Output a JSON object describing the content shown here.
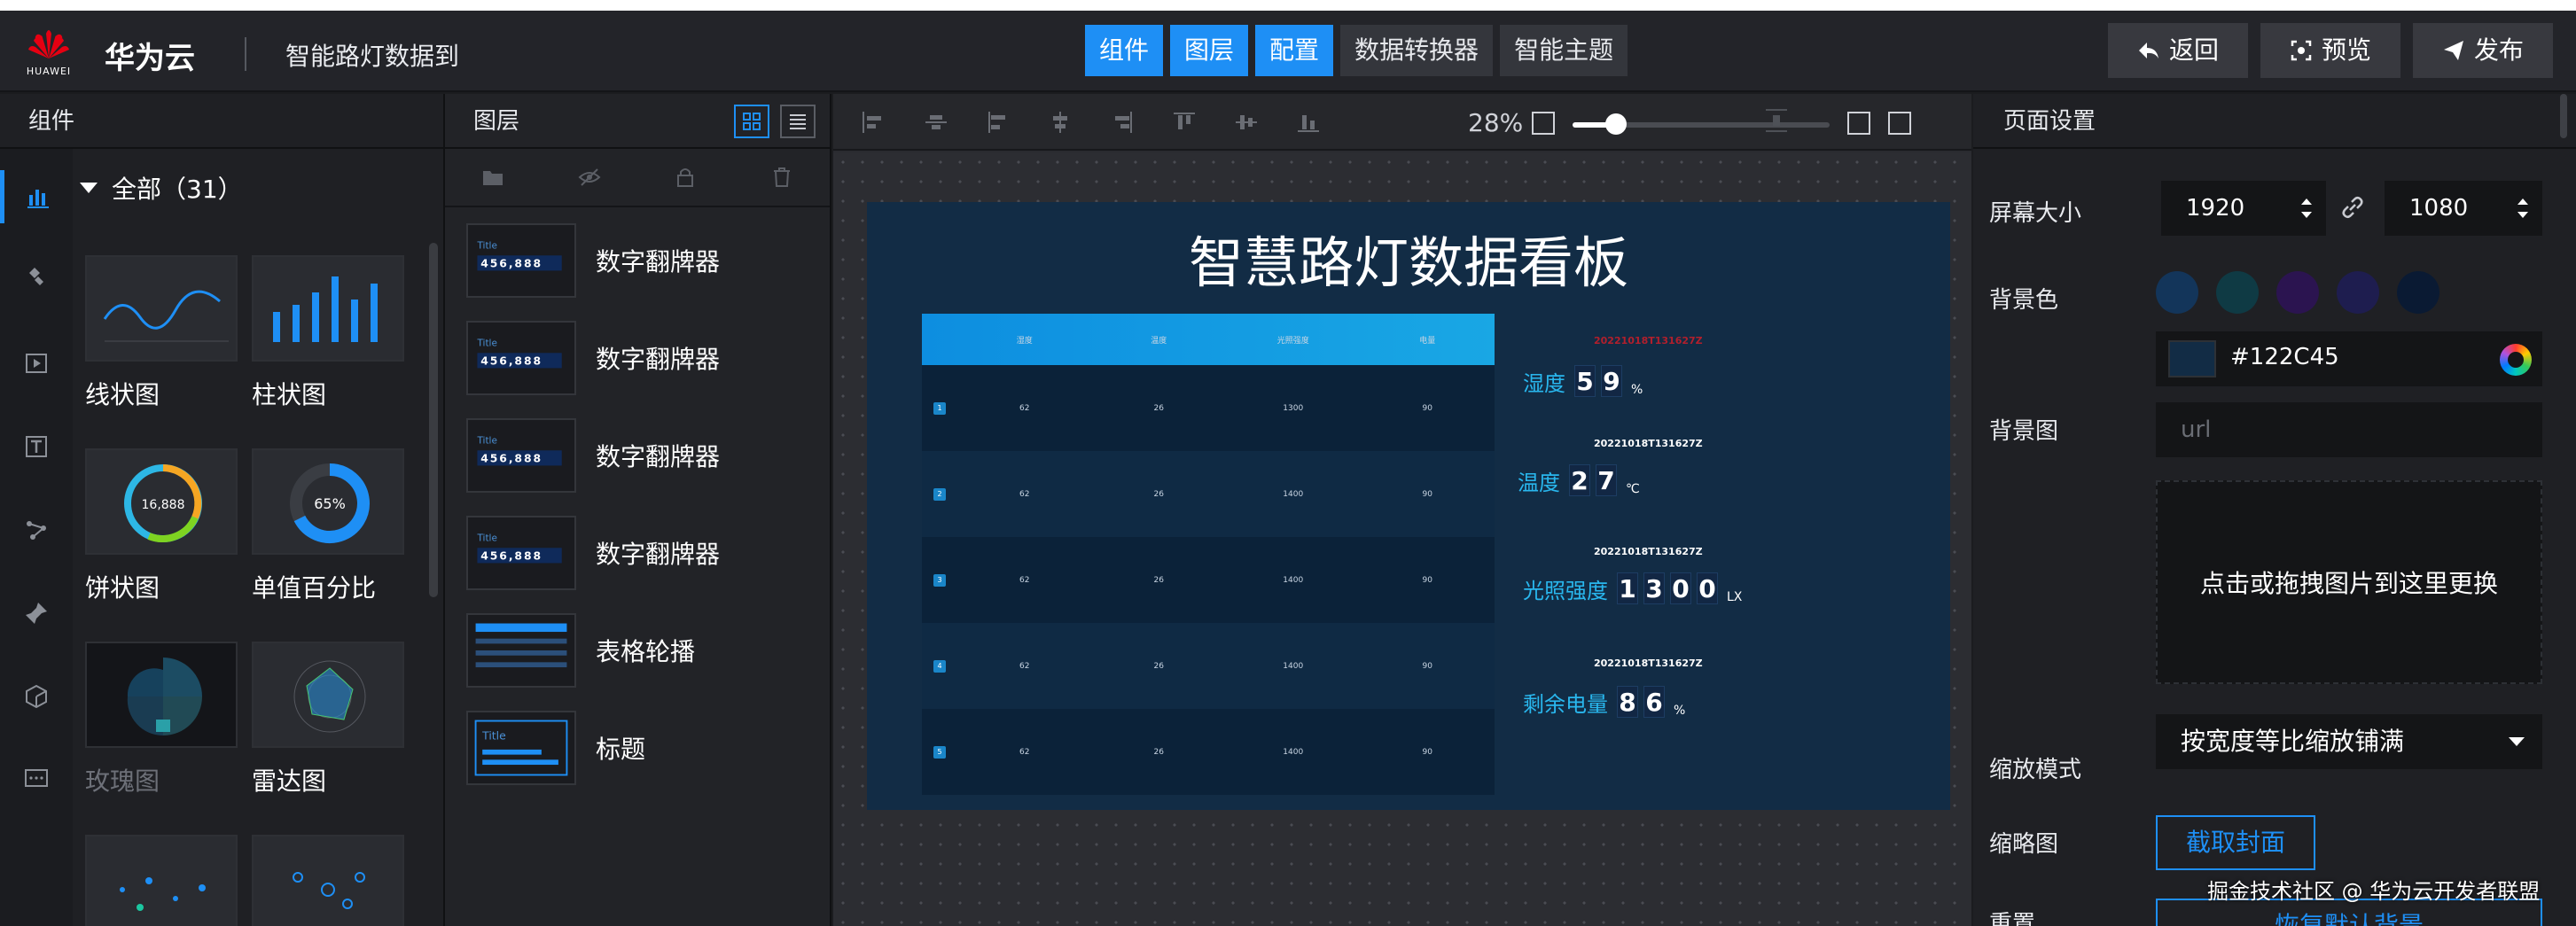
{
  "header": {
    "logo_text": "HUAWEI",
    "brand": "华为云",
    "project_name": "智能路灯数据到",
    "center_tabs": [
      {
        "label": "组件",
        "active": true
      },
      {
        "label": "图层",
        "active": true
      },
      {
        "label": "配置",
        "active": true
      },
      {
        "label": "数据转换器",
        "active": false
      },
      {
        "label": "智能主题",
        "active": false
      }
    ],
    "back_label": "返回",
    "preview_label": "预览",
    "publish_label": "发布"
  },
  "components_panel": {
    "title": "组件",
    "category": "全部（31）",
    "items": [
      {
        "label": "线状图",
        "icon": "line-chart-thumb",
        "disabled": false
      },
      {
        "label": "柱状图",
        "icon": "bar-chart-thumb",
        "disabled": false
      },
      {
        "label": "饼状图",
        "icon": "pie-chart-thumb",
        "thumb_value": "16,888",
        "disabled": false
      },
      {
        "label": "单值百分比",
        "icon": "percent-ring-thumb",
        "thumb_value": "65%",
        "disabled": false
      },
      {
        "label": "玫瑰图",
        "icon": "rose-chart-thumb",
        "disabled": true
      },
      {
        "label": "雷达图",
        "icon": "radar-chart-thumb",
        "disabled": false
      }
    ]
  },
  "layers_panel": {
    "title": "图层",
    "items": [
      {
        "label": "数字翻牌器",
        "thumb_text": "Title",
        "thumb_digits": "456,888"
      },
      {
        "label": "数字翻牌器",
        "thumb_text": "Title",
        "thumb_digits": "456,888"
      },
      {
        "label": "数字翻牌器",
        "thumb_text": "Title",
        "thumb_digits": "456,888"
      },
      {
        "label": "数字翻牌器",
        "thumb_text": "Title",
        "thumb_digits": "456,888"
      },
      {
        "label": "表格轮播",
        "thumb_text": "",
        "thumb_digits": ""
      },
      {
        "label": "标题",
        "thumb_text": "Title",
        "thumb_digits": ""
      }
    ]
  },
  "canvas": {
    "zoom_label": "28%",
    "zoom_fraction": 0.17,
    "board_title": "智慧路灯数据看板",
    "table": {
      "headers": [
        "湿度",
        "温度",
        "光照强度",
        "电量"
      ],
      "rows": [
        {
          "idx": "1",
          "cells": [
            "62",
            "26",
            "1300",
            "90"
          ]
        },
        {
          "idx": "2",
          "cells": [
            "62",
            "26",
            "1400",
            "90"
          ]
        },
        {
          "idx": "3",
          "cells": [
            "62",
            "26",
            "1400",
            "90"
          ]
        },
        {
          "idx": "4",
          "cells": [
            "62",
            "26",
            "1400",
            "90"
          ]
        },
        {
          "idx": "5",
          "cells": [
            "62",
            "26",
            "1400",
            "90"
          ]
        }
      ]
    },
    "flip_cards": [
      {
        "date": "20221018T131627Z",
        "label": "湿度",
        "digits": [
          "5",
          "9"
        ],
        "unit": "%"
      },
      {
        "date": "20221018T131627Z",
        "label": "温度",
        "digits": [
          "2",
          "7"
        ],
        "unit": "℃"
      },
      {
        "date": "20221018T131627Z",
        "label": "光照强度",
        "digits": [
          "1",
          "3",
          "0",
          "0"
        ],
        "unit": "LX"
      },
      {
        "date": "20221018T131627Z",
        "label": "剩余电量",
        "digits": [
          "8",
          "6"
        ],
        "unit": "%"
      }
    ]
  },
  "settings_panel": {
    "title": "页面设置",
    "screen_size_label": "屏幕大小",
    "width": "1920",
    "height": "1080",
    "bg_color_label": "背景色",
    "swatches": [
      "#13355a",
      "#0f3a44",
      "#2b1450",
      "#1e1d4f",
      "#0a1a33"
    ],
    "bg_color_value": "#122C45",
    "bg_image_label": "背景图",
    "url_placeholder": "url",
    "drop_text": "点击或拖拽图片到这里更换",
    "scale_mode_label": "缩放模式",
    "scale_mode_value": "按宽度等比缩放铺满",
    "thumbnail_label": "缩略图",
    "capture_label": "截取封面",
    "reset_label": "重置",
    "reset_button_label": "恢复默认背景"
  },
  "watermark": "掘金技术社区 @ 华为云开发者联盟",
  "colors": {
    "accent": "#1e8ff5",
    "panel_bg": "#1f2024",
    "board_bg": "#122c45"
  }
}
